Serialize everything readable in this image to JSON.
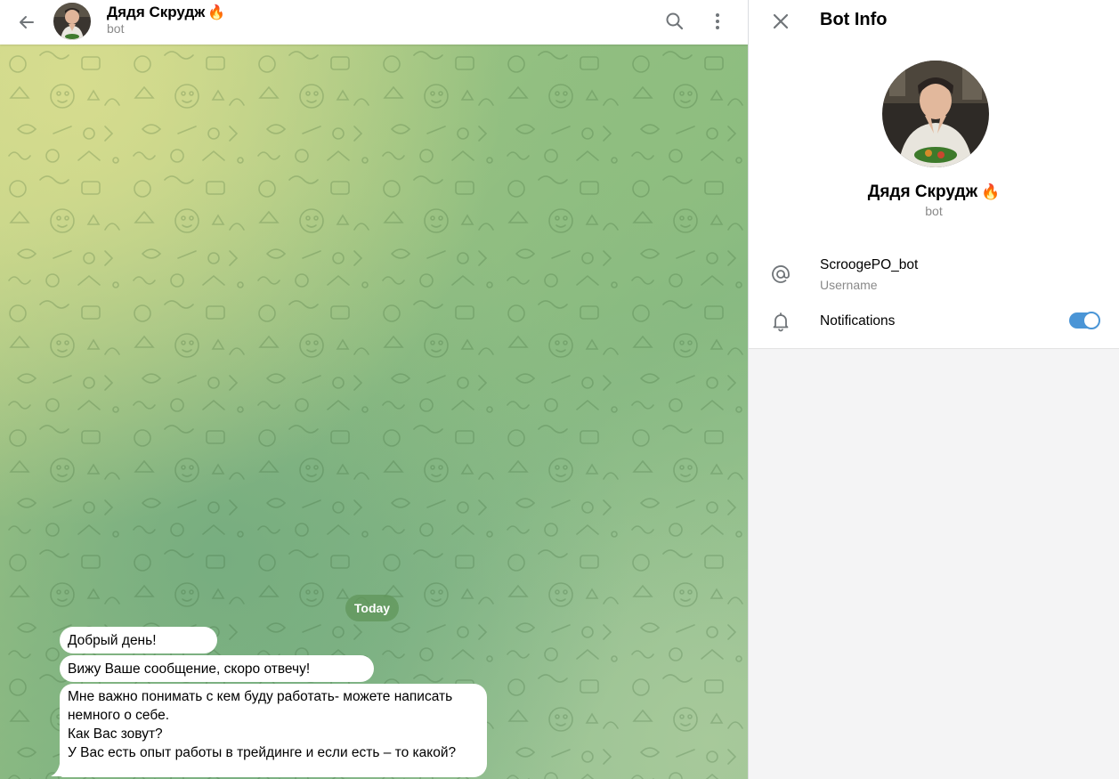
{
  "colors": {
    "accent": "#4a95d6",
    "bubble": "#ffffff",
    "date_pill": "#60965a",
    "subtext": "#8a8a8a"
  },
  "chat": {
    "title": "Дядя Скрудж",
    "title_emoji": "🔥",
    "subtitle": "bot",
    "icons": {
      "back": "arrow-left-icon",
      "search": "search-icon",
      "more": "more-vertical-icon"
    }
  },
  "messages": {
    "date": "Today",
    "items": [
      {
        "text": "Добрый день!"
      },
      {
        "text": "Вижу Ваше сообщение, скоро отвечу!"
      },
      {
        "text": "Мне важно понимать с кем буду работать- можете написать немного о себе.\nКак Вас зовут?\nУ Вас есть опыт работы в трейдинге и если есть – то какой?"
      }
    ]
  },
  "panel": {
    "title": "Bot Info",
    "name": "Дядя Скрудж",
    "name_emoji": "🔥",
    "subtitle": "bot",
    "username": {
      "value": "ScroogePO_bot",
      "label": "Username",
      "icon": "at-sign-icon"
    },
    "notifications": {
      "label": "Notifications",
      "enabled": true,
      "icon": "bell-icon"
    },
    "icons": {
      "close": "close-icon"
    }
  }
}
